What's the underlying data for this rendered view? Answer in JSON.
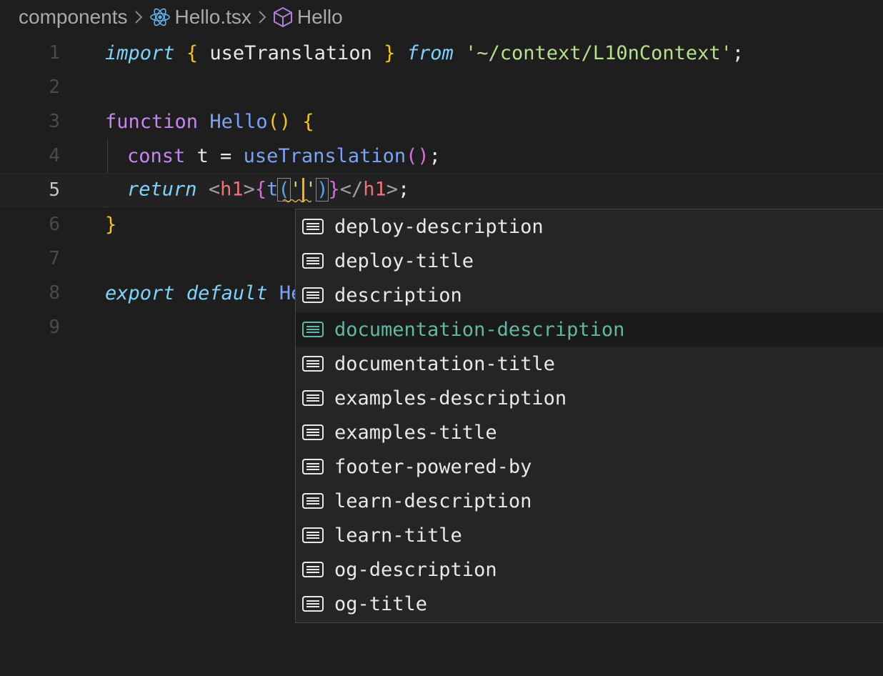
{
  "breadcrumb": {
    "folder": "components",
    "file": "Hello.tsx",
    "symbol": "Hello",
    "file_icon": "react-icon",
    "symbol_icon": "cube-icon",
    "separator_icon": "chevron-right-icon"
  },
  "editor": {
    "current_line": 5,
    "lines": [
      {
        "number": "1"
      },
      {
        "number": "2"
      },
      {
        "number": "3"
      },
      {
        "number": "4"
      },
      {
        "number": "5"
      },
      {
        "number": "6"
      },
      {
        "number": "7"
      },
      {
        "number": "8"
      },
      {
        "number": "9"
      }
    ],
    "tokens": {
      "l1_import": "import",
      "l1_open": "{",
      "l1_name": " useTranslation ",
      "l1_close": "}",
      "l1_from": "from",
      "l1_path": "'~/context/L10nContext'",
      "l1_semi": ";",
      "l3_function": "function",
      "l3_name": "Hello",
      "l3_parens": "()",
      "l3_brace": "{",
      "l4_const": "const",
      "l4_t": " t = ",
      "l4_call": "useTranslation",
      "l4_parens": "()",
      "l4_semi": ";",
      "l5_return": "return",
      "l5_lt1": "<",
      "l5_h1a": "h1",
      "l5_gt1": ">",
      "l5_ob": "{",
      "l5_t": "t",
      "l5_op": "(",
      "l5_q1": "'",
      "l5_q2": "'",
      "l5_cp": ")",
      "l5_cb": "}",
      "l5_lt2": "</",
      "l5_h1b": "h1",
      "l5_gt2": ">",
      "l5_semi": ";",
      "l6_brace": "}",
      "l8_export": "export",
      "l8_default": "default",
      "l8_name": "He"
    }
  },
  "suggestions": {
    "icon": "text-lines-icon",
    "selected_index": 3,
    "items": [
      {
        "label": "deploy-description"
      },
      {
        "label": "deploy-title"
      },
      {
        "label": "description"
      },
      {
        "label": "documentation-description"
      },
      {
        "label": "documentation-title"
      },
      {
        "label": "examples-description"
      },
      {
        "label": "examples-title"
      },
      {
        "label": "footer-powered-by"
      },
      {
        "label": "learn-description"
      },
      {
        "label": "learn-title"
      },
      {
        "label": "og-description"
      },
      {
        "label": "og-title"
      }
    ]
  },
  "colors": {
    "background": "#1e1e1e",
    "selected_suggestion_text": "#5fb9a4",
    "cursor": "#f5b800"
  }
}
